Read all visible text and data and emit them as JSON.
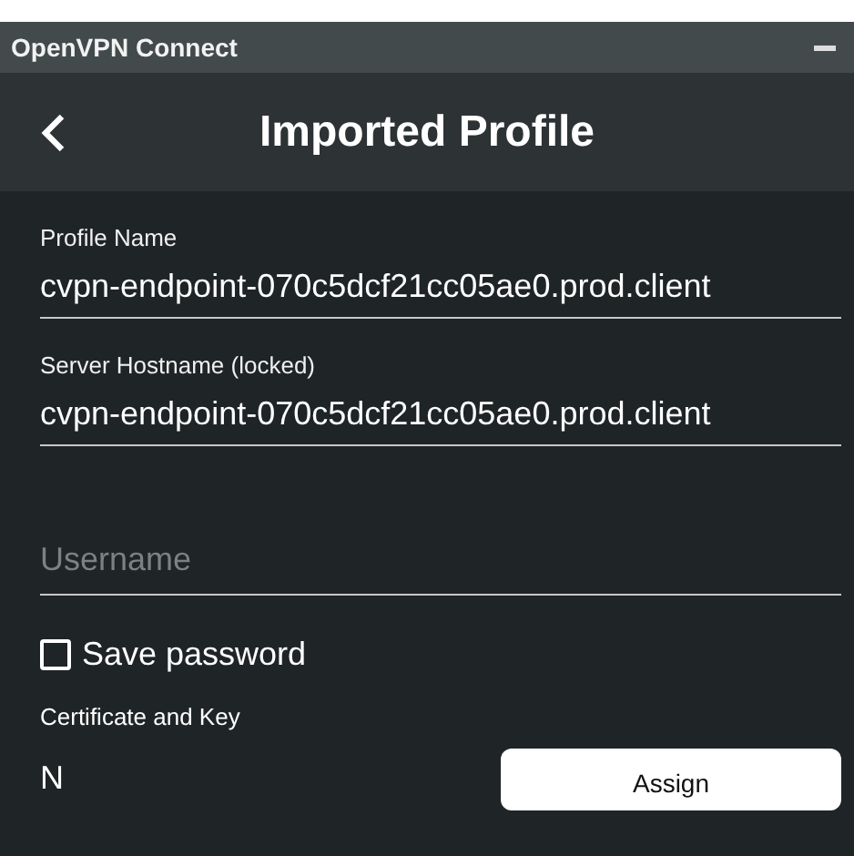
{
  "window": {
    "title": "OpenVPN Connect"
  },
  "header": {
    "title": "Imported Profile"
  },
  "fields": [
    {
      "kind": "readonly",
      "label": "Profile Name",
      "value": "cvpn-endpoint-070c5dcf21cc05ae0.prod.client"
    },
    {
      "kind": "readonly",
      "label": "Server Hostname (locked)",
      "value": "cvpn-endpoint-070c5dcf21cc05ae0.prod.client"
    },
    {
      "kind": "input",
      "placeholder": "Username"
    }
  ],
  "save_password": {
    "label": "Save password",
    "checked": false
  },
  "certificate": {
    "label": "Certificate and Key",
    "value": "N",
    "button": "Assign"
  }
}
